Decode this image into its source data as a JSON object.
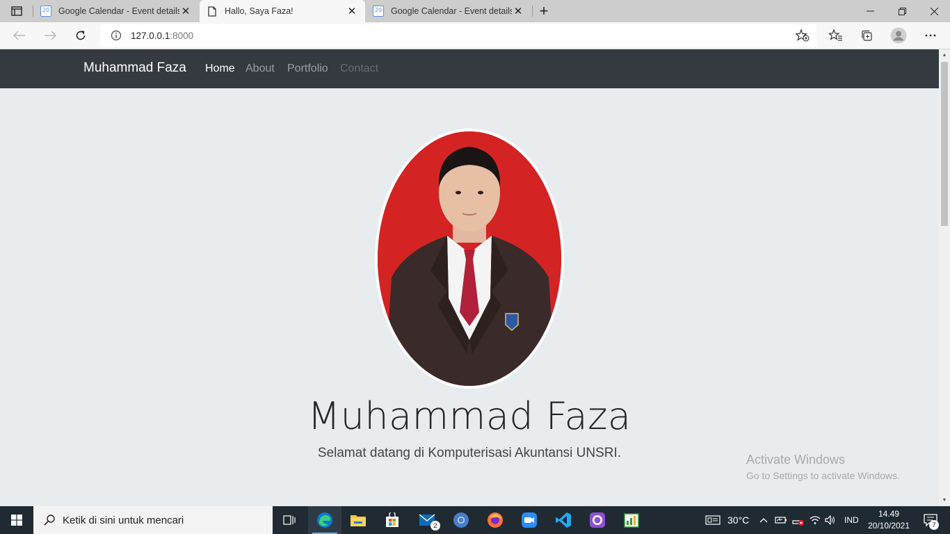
{
  "browser": {
    "tabs": [
      {
        "title": "Google Calendar - Event details",
        "icon": "calendar-icon",
        "active": false
      },
      {
        "title": "Hallo, Saya Faza!",
        "icon": "page-icon",
        "active": true
      },
      {
        "title": "Google Calendar - Event details",
        "icon": "calendar-icon",
        "active": false
      }
    ],
    "calendar_icon_text": "20",
    "close_glyph": "✕",
    "new_tab_glyph": "+",
    "url_host": "127.0.0.1",
    "url_port": ":8000"
  },
  "site": {
    "brand": "Muhammad Faza",
    "nav": [
      {
        "label": "Home",
        "state": "active"
      },
      {
        "label": "About",
        "state": "normal"
      },
      {
        "label": "Portfolio",
        "state": "normal"
      },
      {
        "label": "Contact",
        "state": "disabled"
      }
    ],
    "hero_name": "Muhammad Faza",
    "hero_subtitle": "Selamat datang di Komputerisasi Akuntansi UNSRI.",
    "colors": {
      "navbar": "#343a40",
      "background": "#e9ecef",
      "portrait_bg": "#d42323"
    }
  },
  "watermark": {
    "line1": "Activate Windows",
    "line2": "Go to Settings to activate Windows."
  },
  "taskbar": {
    "search_placeholder": "Ketik di sini untuk mencari",
    "mail_badge": "2",
    "temperature": "30°C",
    "language": "IND",
    "time": "14.49",
    "date": "20/10/2021",
    "notification_count": "7"
  }
}
